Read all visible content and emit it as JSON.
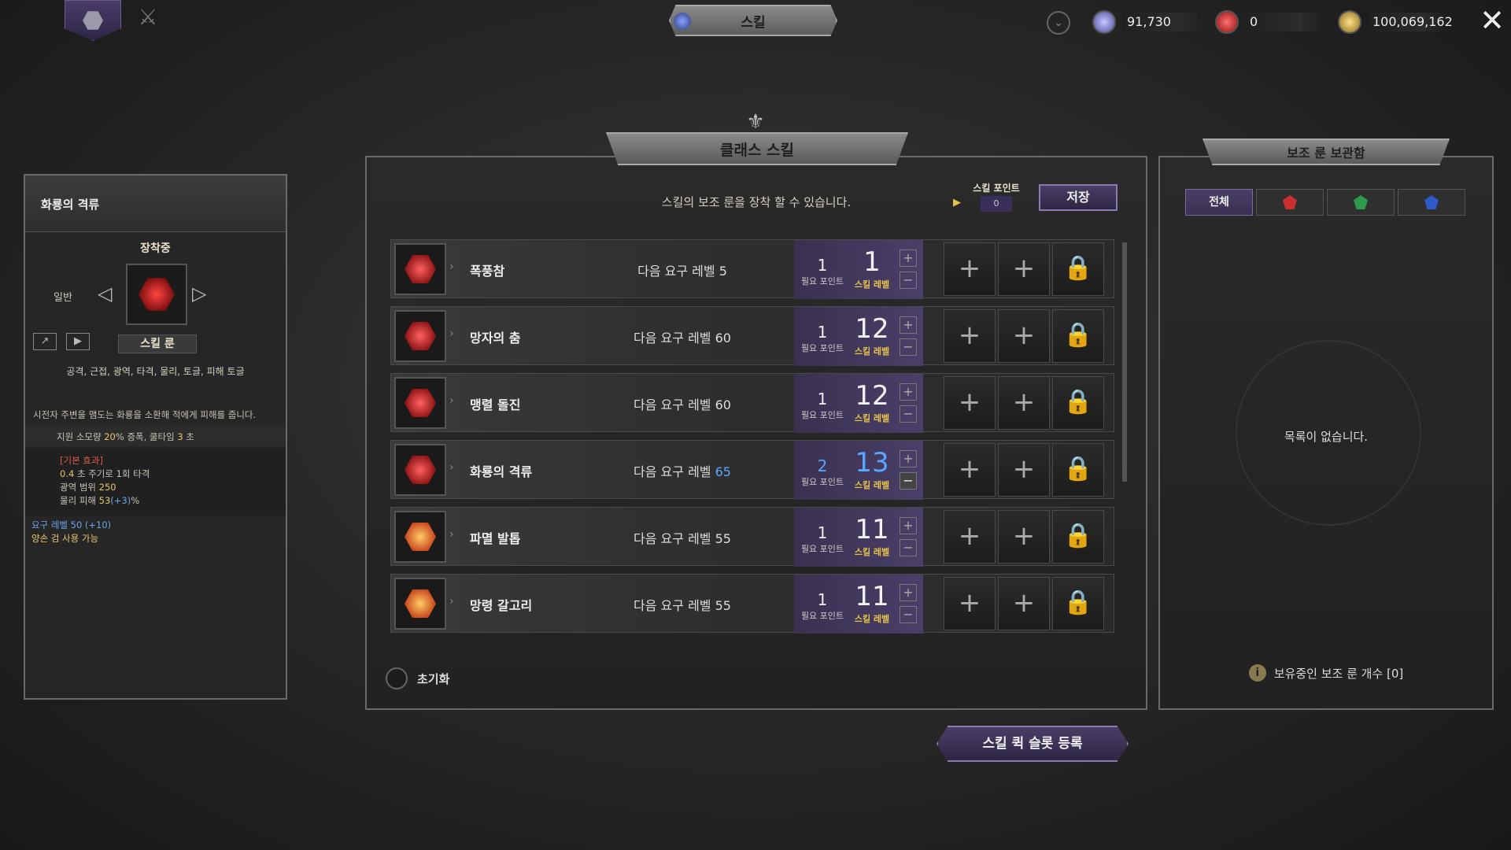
{
  "header": {
    "title": "스킬",
    "currencies": [
      {
        "value": "91,730",
        "color": "#8a8aff"
      },
      {
        "value": "0",
        "color": "#e83030"
      },
      {
        "value": "100,069,162",
        "color": "#d4a03a"
      }
    ]
  },
  "left_panel": {
    "skill_name": "화룡의 격류",
    "equipped": "장착중",
    "type": "일반",
    "rune_label": "스킬 룬",
    "tags": "공격, 근접, 광역, 타격, 물리, 토글, 피해 토글",
    "description": "시전자 주변을 맴도는 화룡을 소환해 적에게 피해를 줍니다.",
    "cost_prefix": "지원 소모량",
    "cost_value": "20",
    "cost_mid": "% 증폭, 쿨타임",
    "cost_cd": "3",
    "cost_suffix": "초",
    "stats_header": "[기본 효과]",
    "stat1_val": "0.4",
    "stat1_text": "초 주기로 1회 타격",
    "stat2_text": "광역 범위",
    "stat2_val": "250",
    "stat3_text": "물리 피해",
    "stat3_val": "53",
    "stat3_bonus": "(+3)",
    "stat3_unit": "%",
    "req_level": "요구 레벨 50 (+10)",
    "req_weapon": "양손 검 사용 가능"
  },
  "main": {
    "title": "클래스 스킬",
    "info": "스킬의 보조 룬을 장착 할 수 있습니다.",
    "skill_points_label": "스킬 포인트",
    "skill_points_value": "0",
    "save_label": "저장",
    "need_label": "필요 포인트",
    "level_label": "스킬 레벨",
    "req_prefix": "다음 요구 레벨",
    "reset_label": "초기화",
    "skills": [
      {
        "name": "폭풍참",
        "req": "5",
        "need": "1",
        "level": "1"
      },
      {
        "name": "망자의 춤",
        "req": "60",
        "need": "1",
        "level": "12"
      },
      {
        "name": "맹렬 돌진",
        "req": "60",
        "need": "1",
        "level": "12"
      },
      {
        "name": "화룡의 격류",
        "req": "65",
        "need": "2",
        "level": "13"
      },
      {
        "name": "파멸 발톱",
        "req": "55",
        "need": "1",
        "level": "11"
      },
      {
        "name": "망령 갈고리",
        "req": "55",
        "need": "1",
        "level": "11"
      }
    ]
  },
  "right_panel": {
    "title": "보조 룬 보관함",
    "tab_all": "전체",
    "empty": "목록이 없습니다.",
    "footer": "보유중인 보조 룬 개수 [0]"
  },
  "quick_slot_label": "스킬 퀵 슬롯 등록"
}
